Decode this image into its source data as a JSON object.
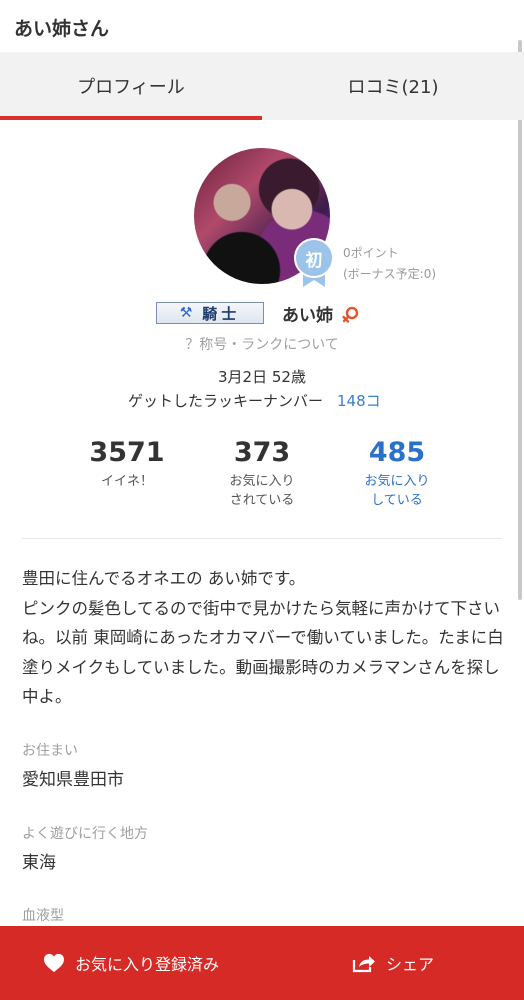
{
  "header": {
    "title": "あい姉さん"
  },
  "tabs": [
    {
      "label": "プロフィール",
      "active": true
    },
    {
      "label": "ロコミ(21)",
      "active": false
    }
  ],
  "profile": {
    "rank_badge": "初",
    "points": "0ポイント",
    "bonus": "(ボーナス予定:0)",
    "title_badge": "騎士",
    "name": "あい姉",
    "rank_help": "？称号・ランクについて",
    "birth": "3月2日 52歳",
    "lucky_label": "ゲットしたラッキーナンバー",
    "lucky_value": "148コ"
  },
  "stats": [
    {
      "value": "3571",
      "label_line1": "イイネ！",
      "label_line2": ""
    },
    {
      "value": "373",
      "label_line1": "お気に入り",
      "label_line2": "されている"
    },
    {
      "value": "485",
      "label_line1": "お気に入り",
      "label_line2": "している"
    }
  ],
  "bio": [
    "豊田に住んでるオネエの あい姉です。",
    "ピンクの髪色してるので街中で見かけたら気軽に声かけて下さいね。以前 東岡崎にあったオカマバーで働いていました。たまに白塗りメイクもしていました。動画撮影時のカメラマンさんを探し中よ。"
  ],
  "fields": [
    {
      "label": "お住まい",
      "value": "愛知県豊田市"
    },
    {
      "label": "よく遊びに行く地方",
      "value": "東海"
    },
    {
      "label": "血液型",
      "value": ""
    }
  ],
  "bottom_bar": {
    "favorite_label": "お気に入り登録済み",
    "share_label": "シェア"
  },
  "colors": {
    "accent_red": "#d52a26",
    "link_blue": "#2a72c9",
    "badge_blue": "#9cc3ea"
  },
  "icons": {
    "favorite": "heart-icon",
    "share": "share-icon",
    "gender": "female-icon",
    "title_tool": "crossed-tools-icon",
    "rank": "ribbon-icon"
  }
}
